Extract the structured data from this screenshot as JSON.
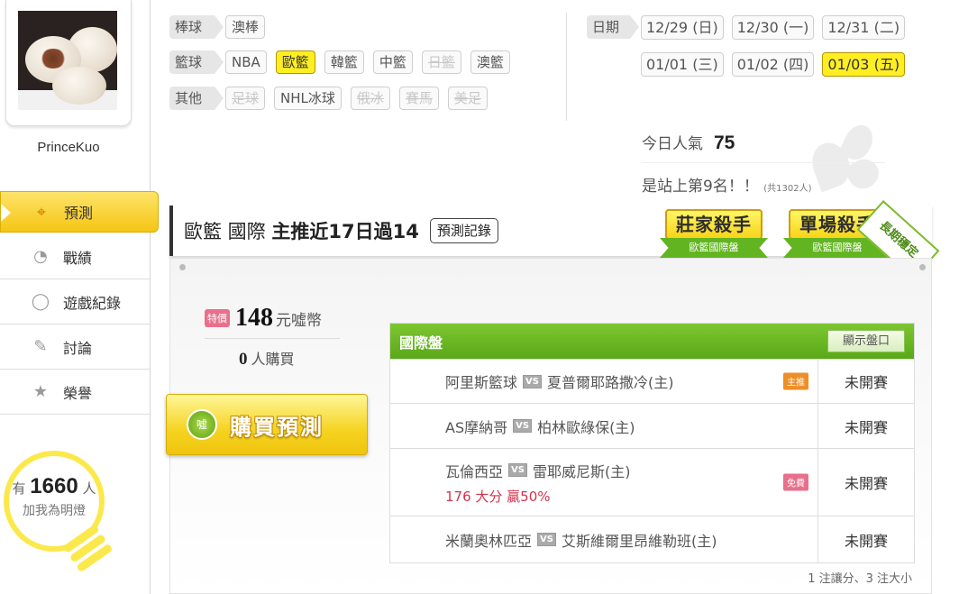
{
  "user": {
    "name": "PrinceKuo"
  },
  "menu": [
    {
      "label": "預測",
      "icon": "target-icon",
      "glyph": "⌖",
      "active": true
    },
    {
      "label": "戰績",
      "icon": "chart-icon",
      "glyph": "◔",
      "active": false
    },
    {
      "label": "遊戲紀錄",
      "icon": "record-icon",
      "glyph": "◯",
      "active": false
    },
    {
      "label": "討論",
      "icon": "discussion-icon",
      "glyph": "✎",
      "active": false
    },
    {
      "label": "榮譽",
      "icon": "honor-icon",
      "glyph": "★",
      "active": false
    }
  ],
  "fans": {
    "prefix": "有",
    "count": "1660",
    "suffix": "人",
    "line2": "加我為明燈"
  },
  "categories": {
    "baseball": {
      "label": "棒球",
      "tags": [
        {
          "text": "澳棒",
          "state": "normal"
        }
      ]
    },
    "basketball": {
      "label": "籃球",
      "tags": [
        {
          "text": "NBA",
          "state": "normal"
        },
        {
          "text": "歐籃",
          "state": "on"
        },
        {
          "text": "韓籃",
          "state": "normal"
        },
        {
          "text": "中籃",
          "state": "normal"
        },
        {
          "text": "日籃",
          "state": "off"
        },
        {
          "text": "澳籃",
          "state": "normal"
        }
      ]
    },
    "other": {
      "label": "其他",
      "tags": [
        {
          "text": "足球",
          "state": "off"
        },
        {
          "text": "NHL冰球",
          "state": "normal"
        },
        {
          "text": "俄冰",
          "state": "off"
        },
        {
          "text": "賽馬",
          "state": "off"
        },
        {
          "text": "美足",
          "state": "off"
        }
      ]
    }
  },
  "dates": {
    "label": "日期",
    "items": [
      {
        "text": "12/29 (日)",
        "state": "normal"
      },
      {
        "text": "12/30 (一)",
        "state": "normal"
      },
      {
        "text": "12/31 (二)",
        "state": "normal"
      },
      {
        "text": "01/01 (三)",
        "state": "normal"
      },
      {
        "text": "01/02 (四)",
        "state": "normal"
      },
      {
        "text": "01/03 (五)",
        "state": "on"
      }
    ]
  },
  "popularity": {
    "label": "今日人氣",
    "value": "75",
    "rank_text": "是站上第9名！！",
    "rank_total": "(共1302人)"
  },
  "header": {
    "league": "歐籃 國際",
    "streak": "主推近17日過14",
    "record_button": "預測記錄",
    "badges": [
      {
        "title": "莊家殺手",
        "sub": "歐籃國際盤"
      },
      {
        "title": "單場殺手",
        "sub": "歐籃國際盤"
      }
    ],
    "ribbon": "長期穩定"
  },
  "purchase": {
    "special_tag": "特價",
    "price": "148",
    "unit": "元噓幣",
    "buyers": "0",
    "buyers_suffix": "人購買",
    "buy_button": "購買預測",
    "coin": "噓"
  },
  "games": {
    "title": "國際盤",
    "show_odds_button": "顯示盤口",
    "vs": "VS",
    "rows": [
      {
        "away": "阿里斯籃球",
        "home": "夏普爾耶路撒冷(主)",
        "tag": "主推",
        "tag_type": "main",
        "status": "未開賽",
        "ratio": ""
      },
      {
        "away": "AS摩納哥",
        "home": "柏林歐綠保(主)",
        "tag": "",
        "tag_type": "",
        "status": "未開賽",
        "ratio": ""
      },
      {
        "away": "瓦倫西亞",
        "home": "雷耶威尼斯(主)",
        "tag": "免費",
        "tag_type": "free",
        "status": "未開賽",
        "ratio": "176 大分 贏50%"
      },
      {
        "away": "米蘭奧林匹亞",
        "home": "艾斯維爾里昂維勒班(主)",
        "tag": "",
        "tag_type": "",
        "status": "未開賽",
        "ratio": ""
      }
    ],
    "note": "1 注讓分、3 注大小"
  }
}
